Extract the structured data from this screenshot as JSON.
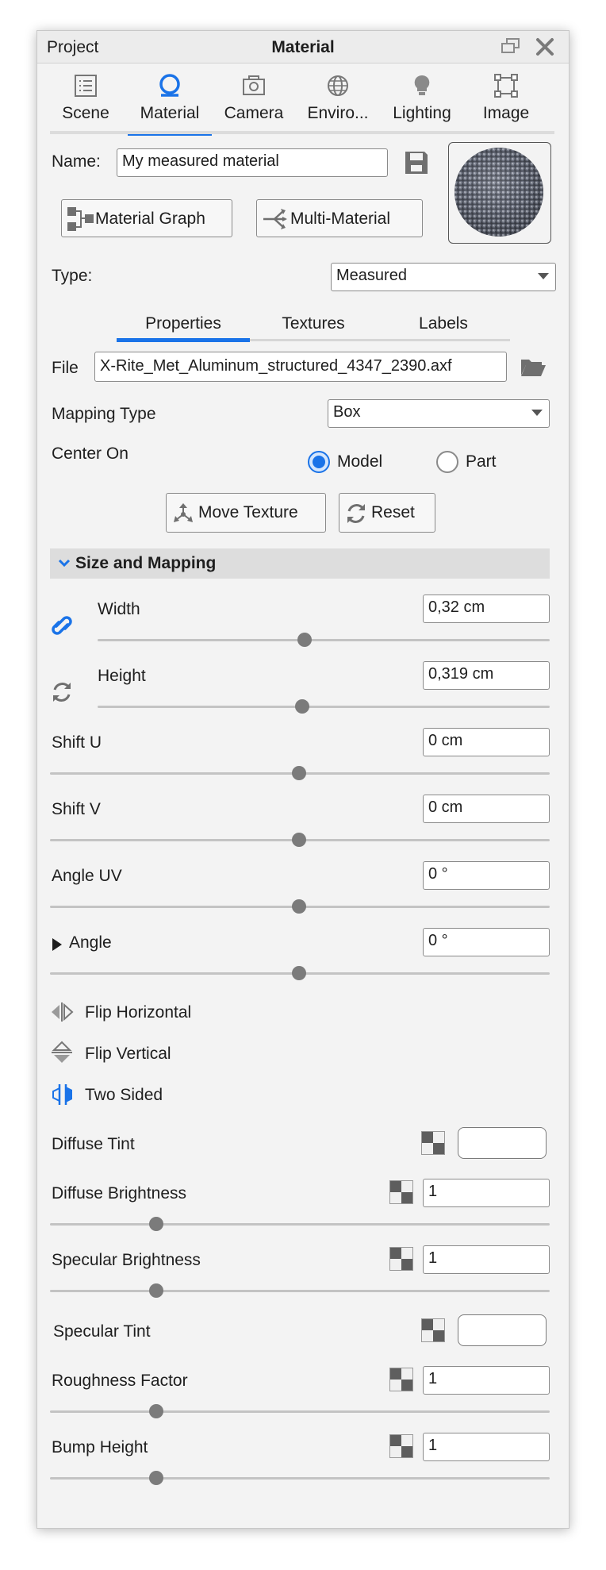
{
  "titlebar": {
    "left": "Project",
    "center": "Material"
  },
  "tabs": [
    {
      "label": "Scene",
      "icon": "scene-icon"
    },
    {
      "label": "Material",
      "icon": "material-icon"
    },
    {
      "label": "Camera",
      "icon": "camera-icon"
    },
    {
      "label": "Enviro...",
      "icon": "environment-icon"
    },
    {
      "label": "Lighting",
      "icon": "lighting-icon"
    },
    {
      "label": "Image",
      "icon": "image-icon"
    }
  ],
  "active_tab": "Material",
  "accent_color": "#1a73e8",
  "name": {
    "label": "Name:",
    "value": "My measured material"
  },
  "buttons": {
    "material_graph": "Material Graph",
    "multi_material": "Multi-Material",
    "move_texture": "Move Texture",
    "reset": "Reset"
  },
  "type": {
    "label": "Type:",
    "value": "Measured"
  },
  "subtabs": [
    "Properties",
    "Textures",
    "Labels"
  ],
  "file": {
    "label": "File",
    "value": "X-Rite_Met_Aluminum_structured_4347_2390.axf"
  },
  "mapping": {
    "label": "Mapping Type",
    "value": "Box"
  },
  "center_on": {
    "label": "Center On",
    "options": [
      "Model",
      "Part"
    ],
    "selected": "Model"
  },
  "section": {
    "title": "Size and Mapping"
  },
  "sliders": [
    {
      "label": "Width",
      "value": "0,32 cm",
      "pos": 0.46
    },
    {
      "label": "Height",
      "value": "0,319 cm",
      "pos": 0.455
    },
    {
      "label": "Shift U",
      "value": "0 cm",
      "pos": 0.5
    },
    {
      "label": "Shift V",
      "value": "0 cm",
      "pos": 0.5
    },
    {
      "label": "Angle UV",
      "value": "0 °",
      "pos": 0.5
    },
    {
      "label": "Angle",
      "value": "0 °",
      "pos": 0.5
    }
  ],
  "toggles": [
    "Flip Horizontal",
    "Flip Vertical",
    "Two Sided"
  ],
  "diffuse_tint": {
    "label": "Diffuse Tint"
  },
  "diffuse_brightness": {
    "label": "Diffuse Brightness",
    "value": "1",
    "pos": 0.21
  },
  "specular_brightness": {
    "label": "Specular Brightness",
    "value": "1",
    "pos": 0.21
  },
  "specular_tint": {
    "label": "Specular Tint"
  },
  "roughness": {
    "label": "Roughness Factor",
    "value": "1",
    "pos": 0.21
  },
  "bump": {
    "label": "Bump Height",
    "value": "1",
    "pos": 0.21
  }
}
